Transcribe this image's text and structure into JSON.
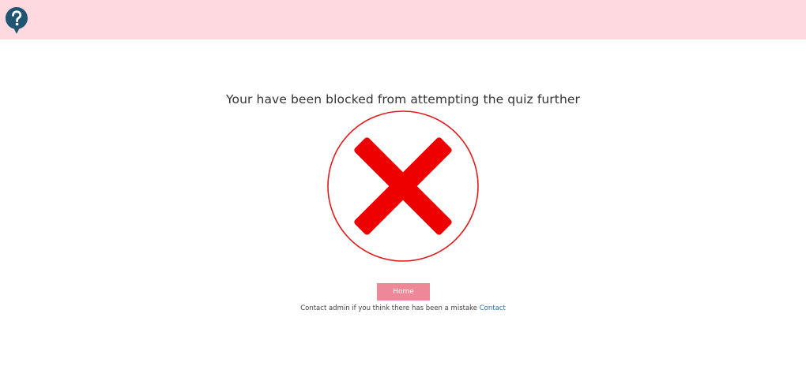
{
  "header": {
    "logo_icon": "question-mark-pin-icon",
    "background_color": "#ffd9e0",
    "logo_color": "#1f5570"
  },
  "main": {
    "message": "Your have been blocked from attempting the quiz further",
    "status_icon": "red-x-cross-icon",
    "status_color": "#ee0000",
    "home_button_label": "Home",
    "home_button_color": "#ee8797",
    "contact_text": "Contact admin if you think there has been a mistake",
    "contact_link_label": "Contact",
    "link_color": "#2f6aa8"
  }
}
